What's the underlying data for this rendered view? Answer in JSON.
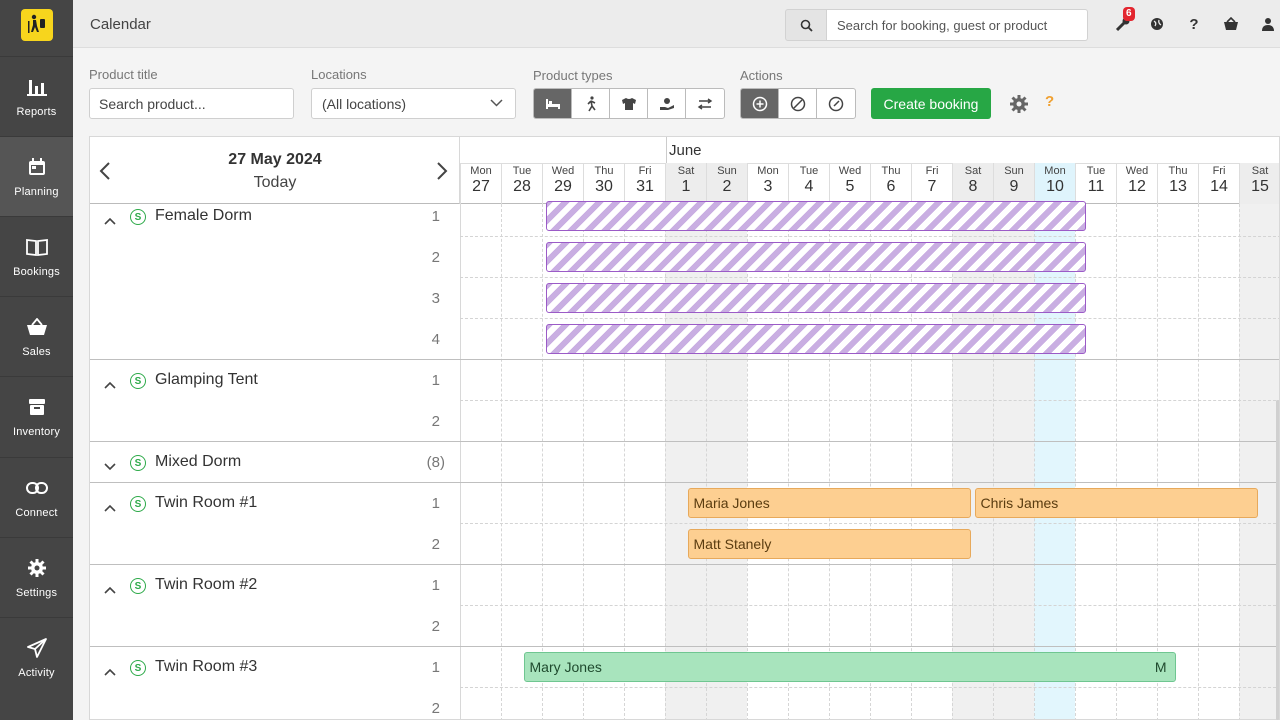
{
  "sidebar": {
    "items": [
      {
        "label": "Reports",
        "icon": "chart-icon"
      },
      {
        "label": "Planning",
        "icon": "calendar-icon"
      },
      {
        "label": "Bookings",
        "icon": "book-icon"
      },
      {
        "label": "Sales",
        "icon": "basket-icon"
      },
      {
        "label": "Inventory",
        "icon": "box-icon"
      },
      {
        "label": "Connect",
        "icon": "link-icon"
      },
      {
        "label": "Settings",
        "icon": "gear-icon"
      },
      {
        "label": "Activity",
        "icon": "paper-plane-icon"
      }
    ],
    "active": "Planning"
  },
  "topbar": {
    "title": "Calendar",
    "search_placeholder": "Search for booking, guest or product",
    "notifications_count": "6"
  },
  "filters": {
    "product_title_label": "Product title",
    "product_title_placeholder": "Search product...",
    "locations_label": "Locations",
    "locations_value": "(All locations)",
    "product_types_label": "Product types",
    "actions_label": "Actions",
    "create_booking_label": "Create booking",
    "help_label": "?"
  },
  "calendar": {
    "date": "27 May 2024",
    "today_label": "Today",
    "month": "June",
    "days": [
      {
        "dow": "Mon",
        "num": "27"
      },
      {
        "dow": "Tue",
        "num": "28"
      },
      {
        "dow": "Wed",
        "num": "29"
      },
      {
        "dow": "Thu",
        "num": "30"
      },
      {
        "dow": "Fri",
        "num": "31"
      },
      {
        "dow": "Sat",
        "num": "1"
      },
      {
        "dow": "Sun",
        "num": "2"
      },
      {
        "dow": "Mon",
        "num": "3"
      },
      {
        "dow": "Tue",
        "num": "4"
      },
      {
        "dow": "Wed",
        "num": "5"
      },
      {
        "dow": "Thu",
        "num": "6"
      },
      {
        "dow": "Fri",
        "num": "7"
      },
      {
        "dow": "Sat",
        "num": "8"
      },
      {
        "dow": "Sun",
        "num": "9"
      },
      {
        "dow": "Mon",
        "num": "10"
      },
      {
        "dow": "Tue",
        "num": "11"
      },
      {
        "dow": "Wed",
        "num": "12"
      },
      {
        "dow": "Thu",
        "num": "13"
      },
      {
        "dow": "Fri",
        "num": "14"
      },
      {
        "dow": "Sat",
        "num": "15"
      }
    ],
    "groups": [
      {
        "name": "Female Dorm",
        "units": [
          "1",
          "2",
          "3",
          "4"
        ],
        "expanded": true
      },
      {
        "name": "Glamping Tent",
        "units": [
          "1",
          "2"
        ],
        "expanded": true
      },
      {
        "name": "Mixed Dorm",
        "count": "(8)",
        "expanded": false
      },
      {
        "name": "Twin Room #1",
        "units": [
          "1",
          "2"
        ],
        "expanded": true
      },
      {
        "name": "Twin Room #2",
        "units": [
          "1",
          "2"
        ],
        "expanded": true
      },
      {
        "name": "Twin Room #3",
        "units": [
          "1",
          "2"
        ],
        "expanded": true
      }
    ],
    "bookings": [
      {
        "guest": "Maria Jones",
        "room": "Twin Room #1",
        "unit": "1"
      },
      {
        "guest": "Chris James",
        "room": "Twin Room #1",
        "unit": "1"
      },
      {
        "guest": "Matt Stanely",
        "room": "Twin Room #1",
        "unit": "2"
      },
      {
        "guest": "Mary Jones",
        "room": "Twin Room #3",
        "unit": "1",
        "suffix": "M"
      }
    ]
  }
}
